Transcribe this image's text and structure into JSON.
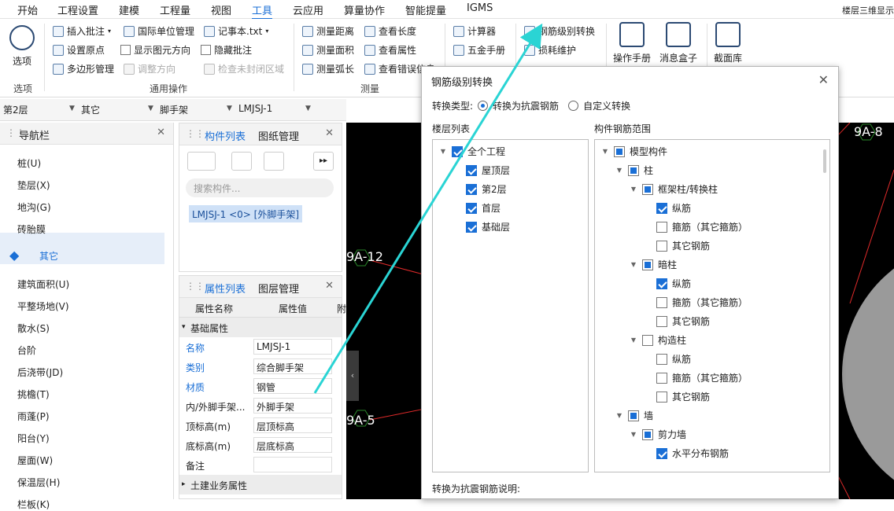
{
  "menubar": {
    "items": [
      "开始",
      "工程设置",
      "建模",
      "工程量",
      "视图",
      "工具",
      "云应用",
      "算量协作",
      "智能提量",
      "IGMS"
    ],
    "active_index": 5,
    "right_text": "楼层三维显示"
  },
  "ribbon": {
    "options_button": "选项",
    "groups": {
      "options": "选项",
      "general": "通用操作",
      "measure": "测量"
    },
    "general_items": [
      "插入批注",
      "国际单位管理",
      "记事本.txt",
      "设置原点",
      "显示图元方向",
      "隐藏批注",
      "多边形管理",
      "调整方向",
      "检查未封闭区域"
    ],
    "measure_items": [
      "测量距离",
      "查看长度",
      "测量面积",
      "查看属性",
      "测量弧长",
      "查看错误信息"
    ],
    "tool_items": [
      "计算器",
      "五金手册",
      "钢筋级别转换",
      "损耗维护"
    ],
    "big_buttons": [
      "操作手册",
      "消息盒子",
      "截面库"
    ]
  },
  "selectors": {
    "floor": "第2层",
    "category": "其它",
    "type": "脚手架",
    "component": "LMJSJ-1"
  },
  "nav": {
    "title": "导航栏",
    "items": [
      "桩(U)",
      "垫层(X)",
      "地沟(G)",
      "砖胎膜",
      "其它",
      "建筑面积(U)",
      "平整场地(V)",
      "散水(S)",
      "台阶",
      "后浇带(JD)",
      "挑檐(T)",
      "雨蓬(P)",
      "阳台(Y)",
      "屋面(W)",
      "保温层(H)",
      "栏板(K)"
    ],
    "selected_index": 4
  },
  "components": {
    "tabs": [
      "构件列表",
      "图纸管理"
    ],
    "search_placeholder": "搜索构件...",
    "item": "LMJSJ-1 <0> [外脚手架]"
  },
  "properties": {
    "tabs": [
      "属性列表",
      "图层管理"
    ],
    "col_name": "属性名称",
    "col_value": "属性值",
    "col_extra": "附",
    "section_basic": "基础属性",
    "section_civil": "土建业务属性",
    "rows": [
      {
        "name": "名称",
        "value": "LMJSJ-1"
      },
      {
        "name": "类别",
        "value": "综合脚手架"
      },
      {
        "name": "材质",
        "value": "钢管"
      },
      {
        "name": "内/外脚手架...",
        "value": "外脚手架"
      },
      {
        "name": "顶标高(m)",
        "value": "层顶标高"
      },
      {
        "name": "底标高(m)",
        "value": "层底标高"
      },
      {
        "name": "备注",
        "value": ""
      }
    ]
  },
  "canvas": {
    "labels": [
      "9A-8",
      "9A-12",
      "9A-5"
    ]
  },
  "dialog": {
    "title": "钢筋级别转换",
    "type_label": "转换类型:",
    "radio_options": [
      "转换为抗震钢筋",
      "自定义转换"
    ],
    "floor_list_label": "楼层列表",
    "scope_label": "构件钢筋范围",
    "floors": [
      {
        "label": "全个工程",
        "checked": true
      },
      {
        "label": "屋顶层",
        "checked": true
      },
      {
        "label": "第2层",
        "checked": true
      },
      {
        "label": "首层",
        "checked": true
      },
      {
        "label": "基础层",
        "checked": true
      }
    ],
    "tree": [
      {
        "label": "模型构件",
        "state": "part",
        "depth": 0
      },
      {
        "label": "柱",
        "state": "part",
        "depth": 1
      },
      {
        "label": "框架柱/转换柱",
        "state": "part",
        "depth": 2
      },
      {
        "label": "纵筋",
        "state": "on",
        "depth": 3
      },
      {
        "label": "箍筋（其它箍筋）",
        "state": "off",
        "depth": 3
      },
      {
        "label": "其它钢筋",
        "state": "off",
        "depth": 3
      },
      {
        "label": "暗柱",
        "state": "part",
        "depth": 2
      },
      {
        "label": "纵筋",
        "state": "on",
        "depth": 3
      },
      {
        "label": "箍筋（其它箍筋）",
        "state": "off",
        "depth": 3
      },
      {
        "label": "其它钢筋",
        "state": "off",
        "depth": 3
      },
      {
        "label": "构造柱",
        "state": "off",
        "depth": 2
      },
      {
        "label": "纵筋",
        "state": "off",
        "depth": 3
      },
      {
        "label": "箍筋（其它箍筋）",
        "state": "off",
        "depth": 3
      },
      {
        "label": "其它钢筋",
        "state": "off",
        "depth": 3
      },
      {
        "label": "墙",
        "state": "part",
        "depth": 1
      },
      {
        "label": "剪力墙",
        "state": "part",
        "depth": 2
      },
      {
        "label": "水平分布钢筋",
        "state": "on",
        "depth": 3
      }
    ],
    "footer_label": "转换为抗震钢筋说明:"
  },
  "colors": {
    "accent": "#1a6fd6",
    "annotation": "#2ad4d4"
  }
}
